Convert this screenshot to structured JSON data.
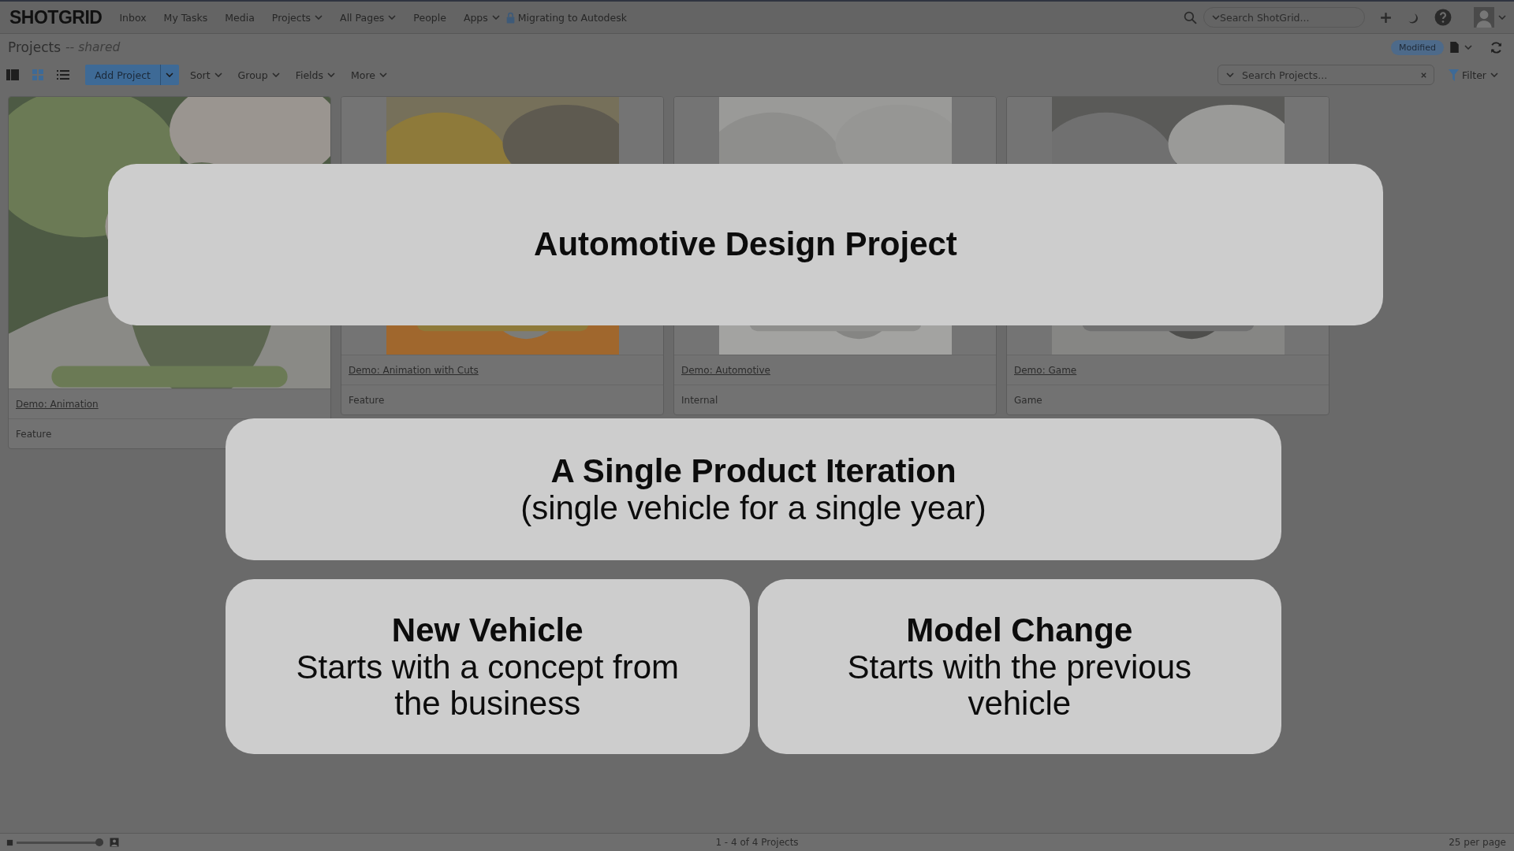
{
  "nav": {
    "logo": "SHOTGRID",
    "items": [
      {
        "label": "Inbox",
        "dropdown": false
      },
      {
        "label": "My Tasks",
        "dropdown": false
      },
      {
        "label": "Media",
        "dropdown": false
      },
      {
        "label": "Projects",
        "dropdown": true
      },
      {
        "label": "All Pages",
        "dropdown": true
      },
      {
        "label": "People",
        "dropdown": false
      },
      {
        "label": "Apps",
        "dropdown": true
      }
    ],
    "migrate": "Migrating to Autodesk",
    "search_placeholder": "Search ShotGrid..."
  },
  "page": {
    "title": "Projects",
    "subtitle": "-- shared",
    "badge": "Modified"
  },
  "toolbar": {
    "views": [
      {
        "kind": "detail",
        "selected": false
      },
      {
        "kind": "grid",
        "selected": true
      },
      {
        "kind": "list",
        "selected": false
      }
    ],
    "add_button": "Add Project",
    "menus": [
      "Sort",
      "Group",
      "Fields",
      "More"
    ],
    "search_placeholder": "Search Projects...",
    "filter": "Filter"
  },
  "projects": [
    {
      "name": "Demo: Animation",
      "type": "Feature",
      "kind": "picture"
    },
    {
      "name": "Demo: Animation with Cuts",
      "type": "Feature",
      "kind": "picture"
    },
    {
      "name": "Demo: Automotive",
      "type": "Internal",
      "kind": "picture"
    },
    {
      "name": "Demo: Game",
      "type": "Game",
      "kind": "picture"
    }
  ],
  "status_bar": {
    "thumb_size": {
      "level": 0.95
    },
    "count": "1 - 4 of 4 Projects",
    "per_page": "25 per page"
  },
  "overlay": {
    "title": "Automotive Design Project",
    "iteration": {
      "title": "A Single Product Iteration",
      "subtitle": "(single vehicle for a single year)"
    },
    "options": [
      {
        "title": "New Vehicle",
        "text": "Starts with a concept from the business"
      },
      {
        "title": "Model Change",
        "text": "Starts with the previous vehicle"
      }
    ]
  }
}
